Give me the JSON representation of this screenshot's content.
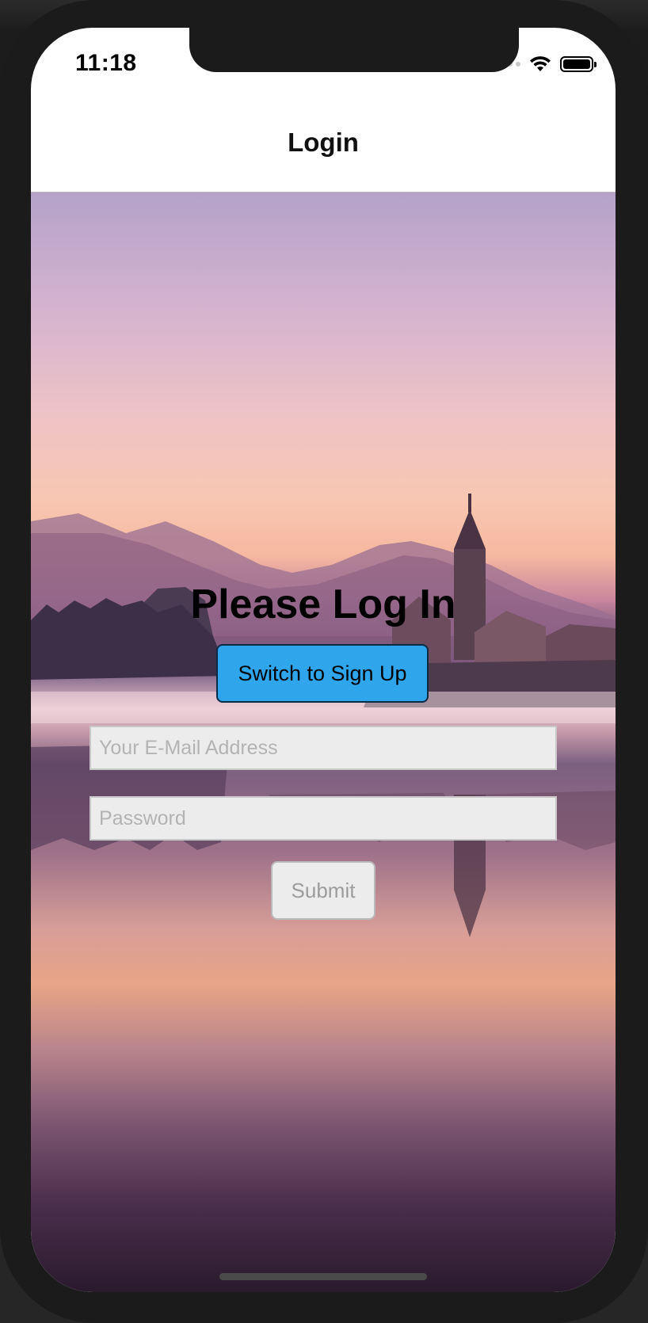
{
  "status_bar": {
    "time": "11:18",
    "icons": [
      "signal-dots-icon",
      "wifi-icon",
      "battery-icon"
    ]
  },
  "nav": {
    "title": "Login"
  },
  "auth": {
    "heading": "Please Log In",
    "switch_label": "Switch to Sign Up",
    "email_placeholder": "Your E-Mail Address",
    "email_value": "",
    "password_placeholder": "Password",
    "password_value": "",
    "submit_label": "Submit"
  },
  "colors": {
    "switch_button": "#2fa6ec",
    "input_background": "#ececec",
    "phone_frame": "#1b1b1b"
  }
}
